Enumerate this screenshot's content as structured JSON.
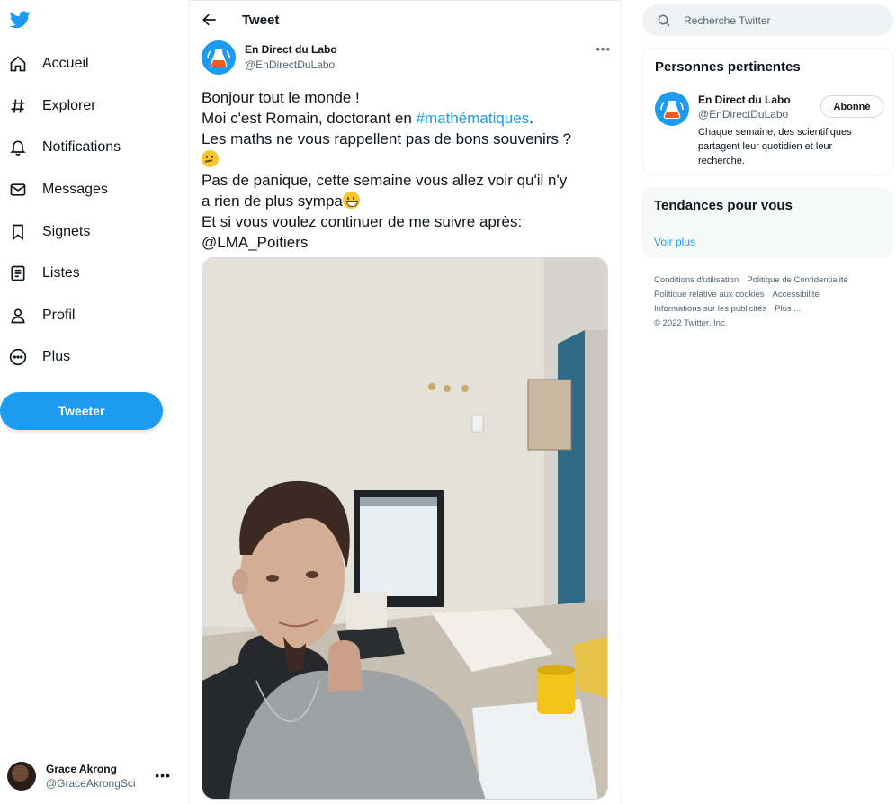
{
  "nav": {
    "items": [
      {
        "label": "Accueil",
        "icon": "home-icon"
      },
      {
        "label": "Explorer",
        "icon": "hashtag-icon"
      },
      {
        "label": "Notifications",
        "icon": "bell-icon"
      },
      {
        "label": "Messages",
        "icon": "envelope-icon"
      },
      {
        "label": "Signets",
        "icon": "bookmark-icon"
      },
      {
        "label": "Listes",
        "icon": "list-icon"
      },
      {
        "label": "Profil",
        "icon": "person-icon"
      },
      {
        "label": "Plus",
        "icon": "more-circle-icon"
      }
    ],
    "tweet_button": "Tweeter",
    "account": {
      "name": "Grace Akrong",
      "handle": "@GraceAkrongSci"
    }
  },
  "main": {
    "title": "Tweet",
    "tweet": {
      "author_name": "En Direct du Labo",
      "author_handle": "@EnDirectDuLabo",
      "lines": [
        "Bonjour tout le monde !",
        "Moi c'est Romain, doctorant en ",
        "#mathématiques",
        ".",
        "Les maths ne vous rappellent pas de bons souvenirs ?",
        "Pas de panique, cette semaine vous allez voir qu'il n'y",
        "a rien de plus sympa",
        "Et si vous voulez continuer de me suivre après:",
        "@LMA_Poitiers"
      ]
    }
  },
  "sidebar": {
    "search_placeholder": "Recherche Twitter",
    "relevant": {
      "title": "Personnes pertinentes",
      "name": "En Direct du Labo",
      "handle": "@EnDirectDuLabo",
      "follow_label": "Abonné",
      "bio": "Chaque semaine, des scientifiques partagent leur quotidien et leur recherche."
    },
    "trends": {
      "title": "Tendances pour vous",
      "more": "Voir plus"
    },
    "footer": [
      "Conditions d'utilisation",
      "Politique de Confidentialité",
      "Politique relative aux cookies",
      "Accessibilité",
      "Informations sur les publicités",
      "Plus ...",
      "© 2022 Twitter, Inc."
    ]
  },
  "colors": {
    "accent": "#1d9bf0",
    "text": "#0f1419",
    "secondary": "#536471"
  }
}
